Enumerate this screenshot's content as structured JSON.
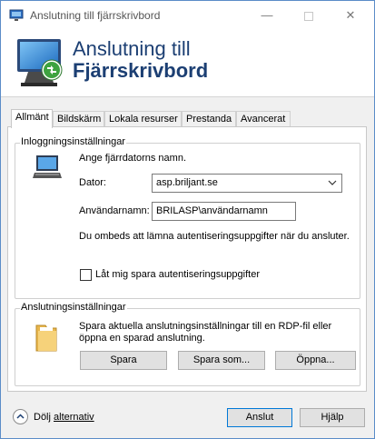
{
  "window": {
    "title": "Anslutning till fjärrskrivbord"
  },
  "banner": {
    "line1": "Anslutning till",
    "line2": "Fjärrskrivbord"
  },
  "tabs": [
    {
      "label": "Allmänt",
      "active": true
    },
    {
      "label": "Bildskärm",
      "active": false
    },
    {
      "label": "Lokala resurser",
      "active": false
    },
    {
      "label": "Prestanda",
      "active": false
    },
    {
      "label": "Avancerat",
      "active": false
    }
  ],
  "login": {
    "group_title": "Inloggningsinställningar",
    "instruction": "Ange fjärrdatorns namn.",
    "computer_label": "Dator:",
    "computer_value": "asp.briljant.se",
    "username_label": "Användarnamn:",
    "username_value": "BRILASP\\användarnamn",
    "credentials_note": "Du ombeds att lämna autentiseringsuppgifter när du ansluter.",
    "save_credentials_label": "Låt mig spara autentiseringsuppgifter",
    "save_credentials_checked": false
  },
  "connection": {
    "group_title": "Anslutningsinställningar",
    "description_line1": "Spara aktuella anslutningsinställningar till en RDP-fil eller",
    "description_line2": "öppna en sparad anslutning.",
    "save_label": "Spara",
    "save_as_label": "Spara som...",
    "open_label": "Öppna..."
  },
  "footer": {
    "hide_options_prefix": "Dölj ",
    "hide_options_underlined": "alternativ",
    "connect_label": "Anslut",
    "help_label": "Hjälp"
  },
  "colors": {
    "banner_text": "#1c3f73",
    "window_border": "#5b8cc8"
  },
  "icons": {
    "title": "remote-desktop-icon",
    "banner": "remote-desktop-monitor-icon",
    "login": "computer-icon",
    "connection": "folder-icon",
    "footer_toggle": "chevron-up-icon",
    "combo": "chevron-down-icon"
  }
}
